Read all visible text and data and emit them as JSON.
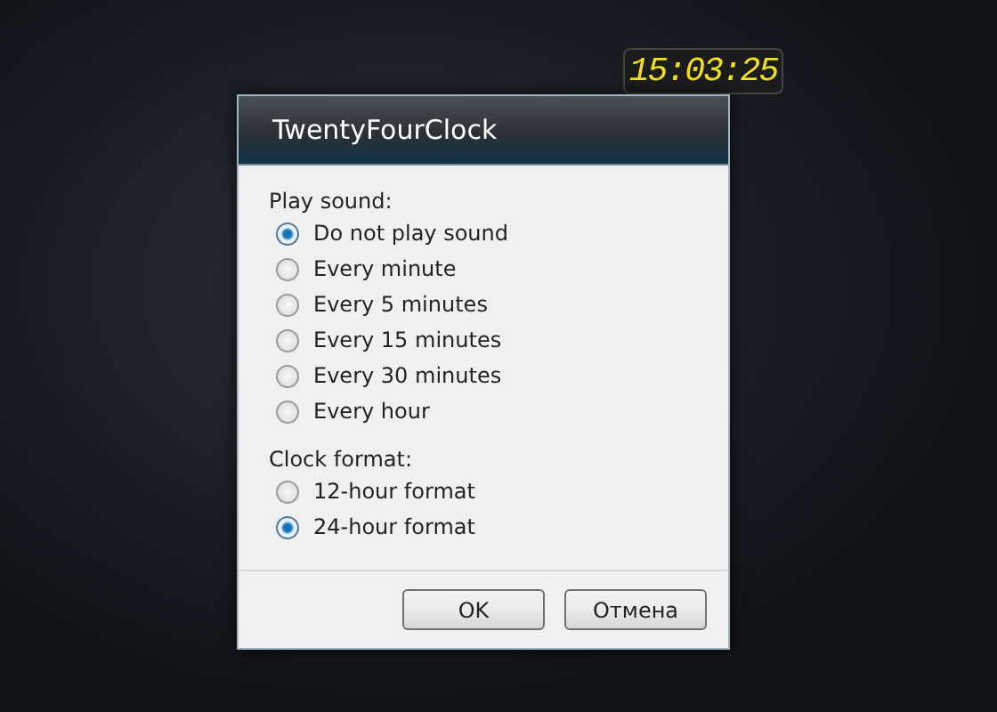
{
  "clock_gadget": {
    "time": "15:03:25"
  },
  "dialog": {
    "title": "TwentyFourClock",
    "groups": [
      {
        "label": "Play sound:",
        "options": [
          {
            "label": "Do not play sound",
            "selected": true
          },
          {
            "label": "Every minute",
            "selected": false
          },
          {
            "label": "Every 5 minutes",
            "selected": false
          },
          {
            "label": "Every 15 minutes",
            "selected": false
          },
          {
            "label": "Every 30 minutes",
            "selected": false
          },
          {
            "label": "Every hour",
            "selected": false
          }
        ]
      },
      {
        "label": "Clock format:",
        "options": [
          {
            "label": "12-hour format",
            "selected": false
          },
          {
            "label": "24-hour format",
            "selected": true
          }
        ]
      }
    ],
    "buttons": [
      "OK",
      "Отмена"
    ]
  }
}
